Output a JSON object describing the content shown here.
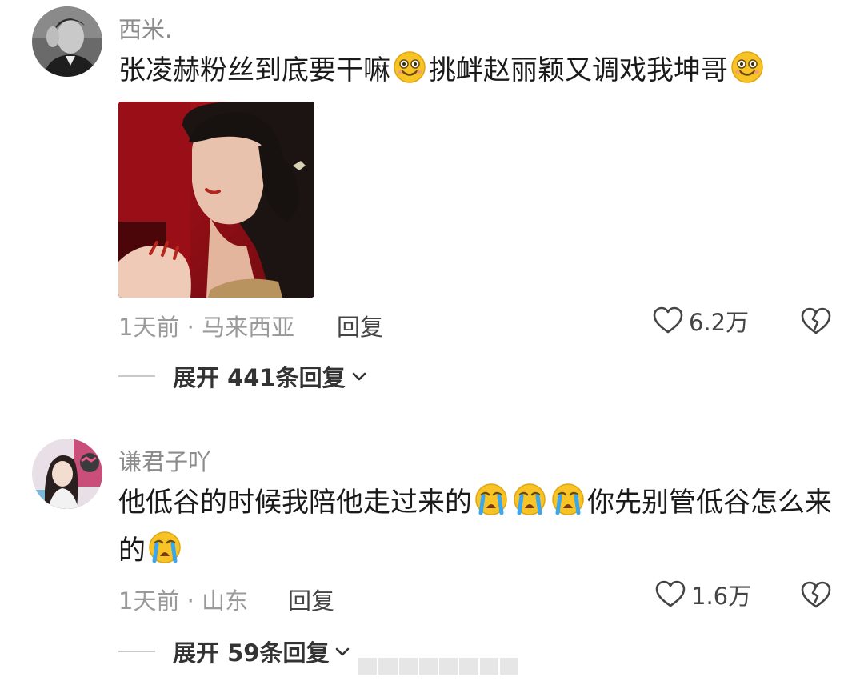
{
  "comments": [
    {
      "username": "西米.",
      "text_part1": "张凌赫粉丝到底要干嘛",
      "text_part2": "挑衅赵丽颖又调戏我坤哥",
      "meta": "1天前 · 马来西亚",
      "reply_label": "回复",
      "likes": "6.2万",
      "expand_label": "展开 441条回复"
    },
    {
      "username": "谦君子吖",
      "text_part1": "他低谷的时候我陪他走过来的",
      "text_part2": "你先别管低谷怎么来的",
      "meta": "1天前 · 山东",
      "reply_label": "回复",
      "likes": "1.6万",
      "expand_label": "展开 59条回复"
    }
  ],
  "icons": {
    "emoji_smile": "smiling-face-emoji",
    "emoji_cry": "loudly-crying-face-emoji",
    "like": "heart-outline-icon",
    "dislike": "broken-heart-icon",
    "expand": "chevron-down-icon"
  },
  "colors": {
    "meta_gray": "#9a9a9a",
    "username_gray": "#8c8c8c",
    "emoji_yellow": "#f7c325"
  }
}
